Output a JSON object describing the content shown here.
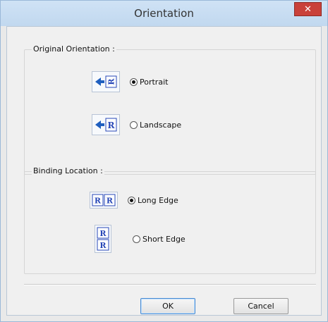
{
  "window": {
    "title": "Orientation",
    "close_glyph": "✕"
  },
  "original_orientation": {
    "label": "Original Orientation :",
    "options": [
      {
        "label": "Portrait",
        "selected": true,
        "icon": "portrait-orientation-icon"
      },
      {
        "label": "Landscape",
        "selected": false,
        "icon": "landscape-orientation-icon"
      }
    ]
  },
  "binding_location": {
    "label": "Binding Location :",
    "options": [
      {
        "label": "Long Edge",
        "selected": true,
        "icon": "long-edge-binding-icon"
      },
      {
        "label": "Short Edge",
        "selected": false,
        "icon": "short-edge-binding-icon"
      }
    ]
  },
  "buttons": {
    "ok": "OK",
    "cancel": "Cancel"
  },
  "icon_letter": "R",
  "colors": {
    "icon_blue": "#2747b7",
    "arrow_blue": "#1f5fbf"
  }
}
